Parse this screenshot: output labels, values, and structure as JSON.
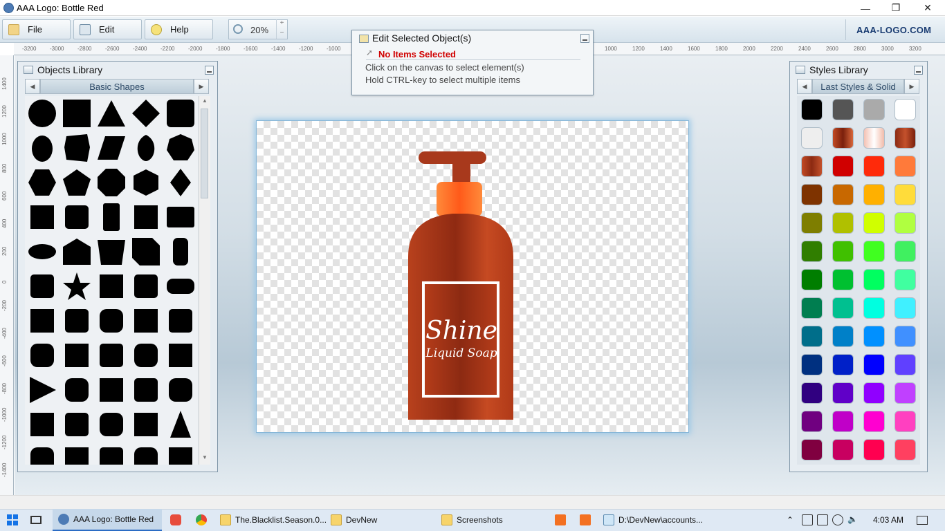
{
  "window": {
    "title": "AAA Logo: Bottle Red",
    "minimize": "—",
    "restore": "❐",
    "close": "✕"
  },
  "toolbar": {
    "file": "File",
    "edit": "Edit",
    "help": "Help",
    "zoom": "20%",
    "zoom_up": "+",
    "zoom_down": "−",
    "brand": "AAA-LOGO.COM"
  },
  "ruler": {
    "h_left": [
      "-3200",
      "-3000",
      "-2800",
      "-2600",
      "-2400",
      "-2200",
      "-2000",
      "-1800",
      "-1600",
      "-1400",
      "-1200",
      "-1000"
    ],
    "h_right": [
      "1000",
      "1200",
      "1400",
      "1600",
      "1800",
      "2000",
      "2200",
      "2400",
      "2600",
      "2800",
      "3000",
      "3200"
    ],
    "v": [
      "1400",
      "1200",
      "1000",
      "800",
      "600",
      "400",
      "200",
      "0",
      "-200",
      "-400",
      "-600",
      "-800",
      "-1000",
      "-1200",
      "-1400"
    ]
  },
  "objects_library": {
    "title": "Objects Library",
    "category": "Basic Shapes",
    "shapes": [
      "circle",
      "square",
      "triangle",
      "diamond",
      "rounded-square",
      "egg",
      "hexagon-slant",
      "parallelogram",
      "drop",
      "heptagon",
      "hexagon",
      "pentagon",
      "octagon",
      "cube",
      "rhombus",
      "heptagon-2",
      "pentagon-2",
      "rounded-rect-tall",
      "hexagon-2",
      "rounded-rect",
      "ellipse",
      "house",
      "trapezoid",
      "folded-corner",
      "pill-tall",
      "square-2",
      "star",
      "star-burst-8",
      "rounded-square-2",
      "pill-wide",
      "leaf",
      "seal",
      "badge",
      "rounded-triangle",
      "shield",
      "pentagon-house",
      "l-shape",
      "corner",
      "wave-square",
      "concave-square",
      "play",
      "rounded-diamond",
      "scalloped",
      "rounded-triangle-2",
      "cloud",
      "burst-sharp",
      "star-8",
      "flower",
      "cross-rounded",
      "cone",
      "arch-1",
      "arch-2",
      "arch-3",
      "trapezoid-2",
      "concave-2"
    ]
  },
  "edit_selected": {
    "title": "Edit Selected Object(s)",
    "status": "No Items Selected",
    "hint1": "Click on the canvas to select element(s)",
    "hint2": "Hold CTRL-key to select multiple items"
  },
  "canvas": {
    "logo_text_1": "Shine",
    "logo_text_2": "Liquid Soap",
    "bottle_colors": {
      "body": "#b2391a",
      "cap": "#ff6a2a",
      "pump": "#a8391c",
      "label_border": "#ffffff"
    }
  },
  "styles_library": {
    "title": "Styles Library",
    "category": "Last Styles & Solid",
    "swatches": [
      "#000000",
      "#555555",
      "#aaaaaa",
      "#ffffff",
      "#eeeeee",
      "grad-red-1",
      "grad-pink",
      "grad-red-2",
      "grad-red-3",
      "#d00000",
      "#ff2a0a",
      "#ff7a3a",
      "#7e3300",
      "#c86800",
      "#ffb000",
      "#ffdc3a",
      "#7e7e00",
      "#b0c000",
      "#d0ff00",
      "#b0ff40",
      "#307e00",
      "#40c000",
      "#40ff20",
      "#40f060",
      "#007e00",
      "#00c030",
      "#00ff60",
      "#40ffa0",
      "#007e50",
      "#00c090",
      "#00ffe0",
      "#40f0ff",
      "#006e8a",
      "#0080c8",
      "#0090ff",
      "#4090ff",
      "#003080",
      "#0020c8",
      "#0000ff",
      "#6040ff",
      "#300080",
      "#6000c8",
      "#9000ff",
      "#c040ff",
      "#700080",
      "#c000c8",
      "#ff00d0",
      "#ff40c0",
      "#800040",
      "#c80060",
      "#ff0050",
      "#ff4060"
    ]
  },
  "taskbar": {
    "items": [
      {
        "label": "AAA Logo: Bottle Red"
      },
      {
        "label": "The.Blacklist.Season.0..."
      },
      {
        "label": "DevNew"
      },
      {
        "label": "Screenshots"
      },
      {
        "label": "D:\\DevNew\\accounts..."
      }
    ],
    "time": "4:03 AM"
  }
}
